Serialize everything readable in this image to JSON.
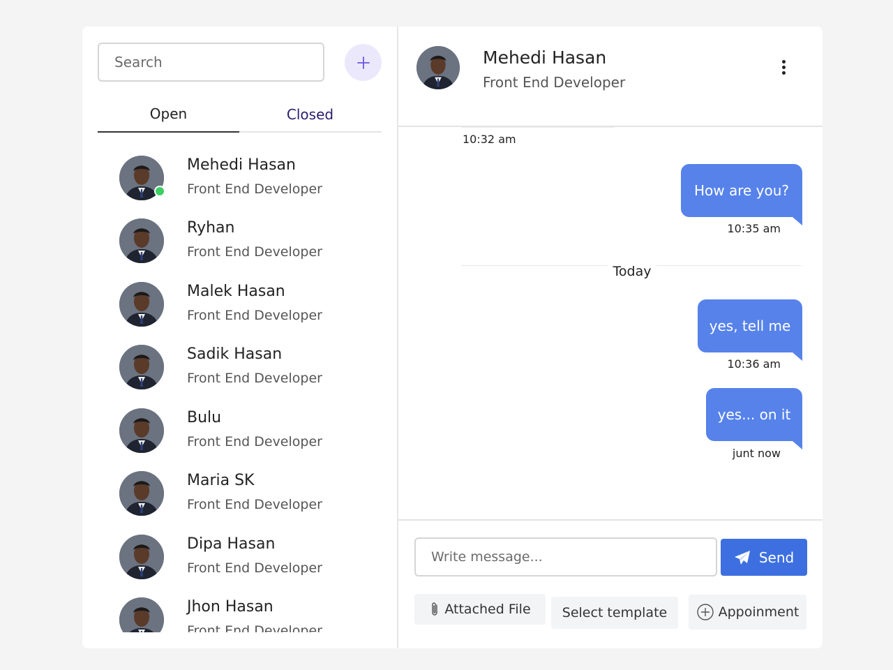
{
  "sidebar": {
    "search_placeholder": "Search",
    "tabs": [
      {
        "label": "Open",
        "active": true
      },
      {
        "label": "Closed",
        "active": false
      }
    ],
    "contacts": [
      {
        "name": "Mehedi Hasan",
        "role": "Front End Developer",
        "online": true
      },
      {
        "name": "Ryhan",
        "role": "Front End Developer",
        "online": false
      },
      {
        "name": "Malek Hasan",
        "role": "Front End Developer",
        "online": false
      },
      {
        "name": "Sadik Hasan",
        "role": "Front End Developer",
        "online": false
      },
      {
        "name": "Bulu",
        "role": "Front End Developer",
        "online": false
      },
      {
        "name": "Maria SK",
        "role": "Front End Developer",
        "online": false
      },
      {
        "name": "Dipa Hasan",
        "role": "Front End Developer",
        "online": false
      },
      {
        "name": "Jhon Hasan",
        "role": "Front End Developer",
        "online": false
      }
    ]
  },
  "chat": {
    "header": {
      "name": "Mehedi Hasan",
      "role": "Front End Developer"
    },
    "messages": {
      "top_time": "10:32 am",
      "m1": {
        "text": "How are you?",
        "time": "10:35 am"
      },
      "divider": "Today",
      "m2": {
        "text": "yes, tell me",
        "time": "10:36 am"
      },
      "m3": {
        "text": "yes... on it",
        "time": "junt now"
      }
    },
    "composer": {
      "placeholder": "Write message...",
      "send_label": "Send",
      "attach_label": "Attached File",
      "template_label": "Select template",
      "appointment_label": "Appoinment"
    }
  },
  "colors": {
    "accent": "#3d6fe0",
    "bubble": "#5682ea",
    "online": "#3ccf63",
    "add_button_bg": "#ece8fc"
  }
}
